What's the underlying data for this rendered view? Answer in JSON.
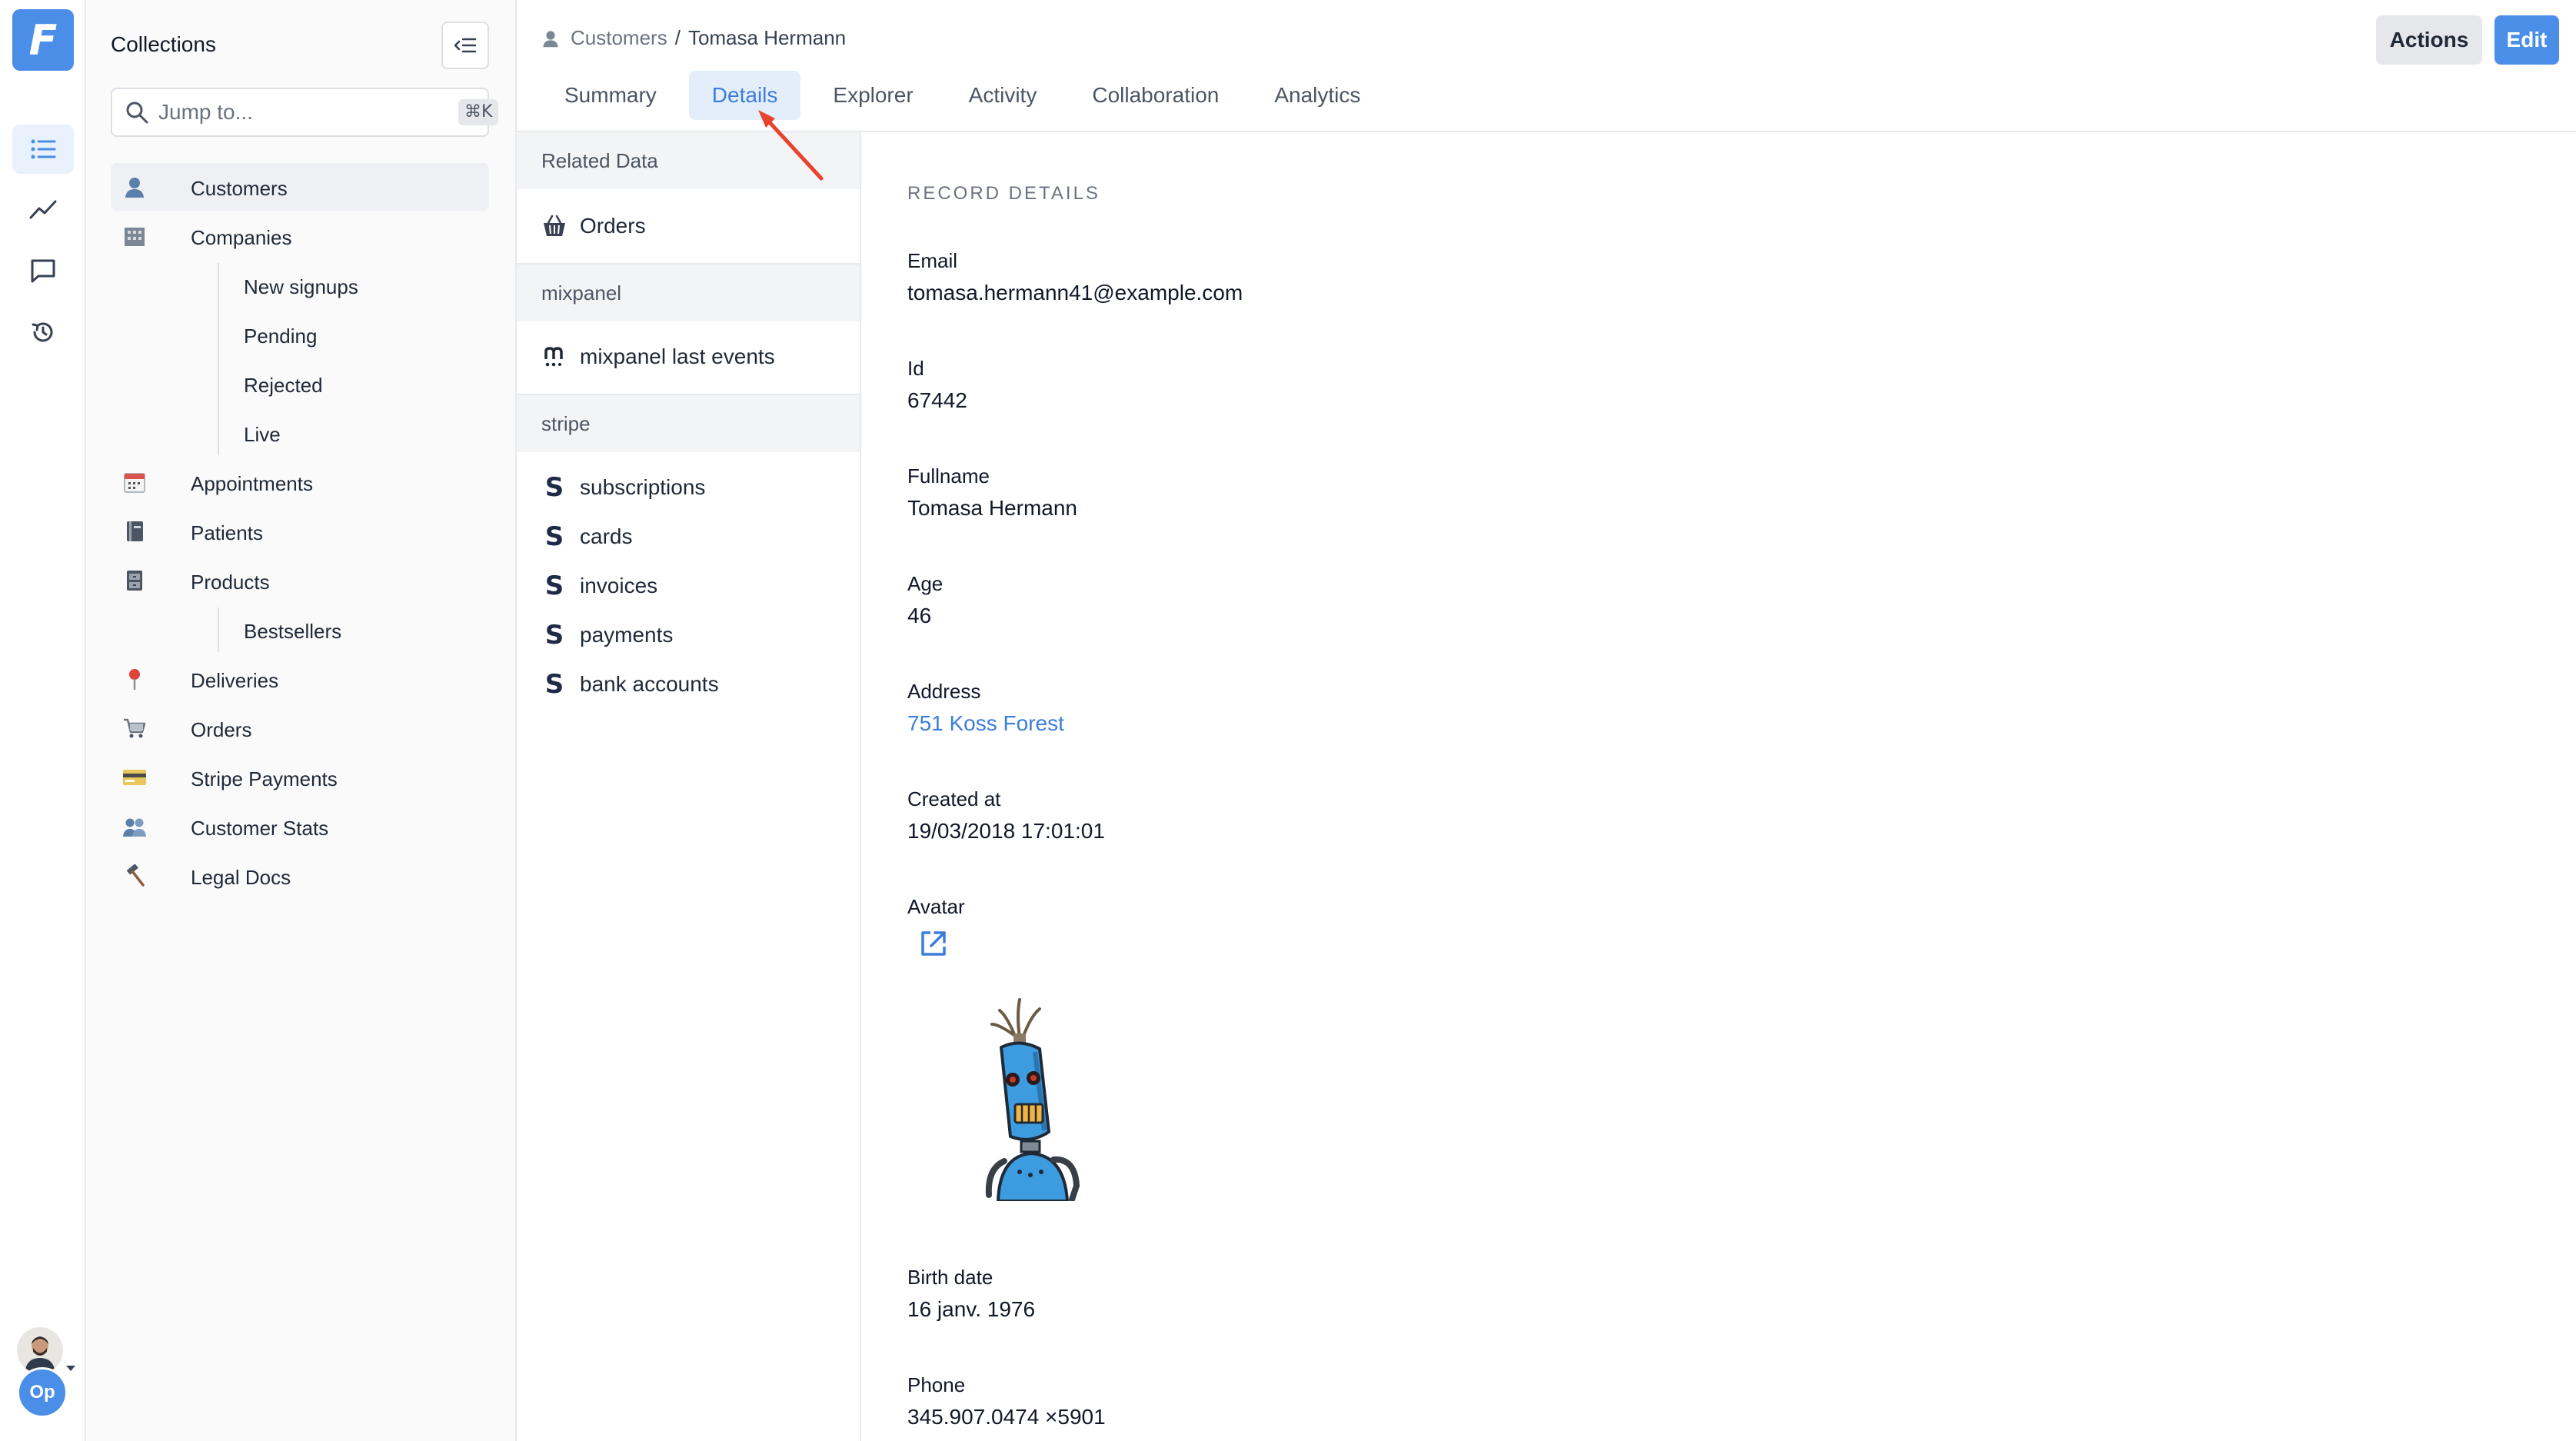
{
  "rail": {
    "logo_letter": "F",
    "org_badge": "Op"
  },
  "collections": {
    "title": "Collections",
    "search": {
      "placeholder": "Jump to...",
      "shortcut": "⌘K"
    },
    "items": [
      {
        "label": "Customers",
        "icon": "person-icon",
        "active": true
      },
      {
        "label": "Companies",
        "icon": "building-icon"
      },
      {
        "label": "New signups",
        "sub": true
      },
      {
        "label": "Pending",
        "sub": true
      },
      {
        "label": "Rejected",
        "sub": true
      },
      {
        "label": "Live",
        "sub": true
      },
      {
        "label": "Appointments",
        "icon": "calendar-icon"
      },
      {
        "label": "Patients",
        "icon": "notebook-icon"
      },
      {
        "label": "Products",
        "icon": "cabinet-icon"
      },
      {
        "label": "Bestsellers",
        "sub": true
      },
      {
        "label": "Deliveries",
        "icon": "pin-icon"
      },
      {
        "label": "Orders",
        "icon": "cart-icon"
      },
      {
        "label": "Stripe Payments",
        "icon": "credit-card-icon"
      },
      {
        "label": "Customer Stats",
        "icon": "people-icon"
      },
      {
        "label": "Legal Docs",
        "icon": "hammer-icon"
      }
    ]
  },
  "header": {
    "breadcrumb": {
      "collection": "Customers",
      "separator": "/",
      "record": "Tomasa Hermann"
    },
    "tabs": [
      "Summary",
      "Details",
      "Explorer",
      "Activity",
      "Collaboration",
      "Analytics"
    ],
    "active_tab": "Details",
    "actions_label": "Actions",
    "edit_label": "Edit"
  },
  "related": {
    "sections": [
      {
        "title": "Related Data",
        "items": [
          {
            "label": "Orders",
            "icon": "basket-icon"
          }
        ]
      },
      {
        "title": "mixpanel",
        "items": [
          {
            "label": "mixpanel last events",
            "icon": "mixpanel-icon"
          }
        ]
      },
      {
        "title": "stripe",
        "items": [
          {
            "label": "subscriptions",
            "icon": "stripe-icon"
          },
          {
            "label": "cards",
            "icon": "stripe-icon"
          },
          {
            "label": "invoices",
            "icon": "stripe-icon"
          },
          {
            "label": "payments",
            "icon": "stripe-icon"
          },
          {
            "label": "bank accounts",
            "icon": "stripe-icon"
          }
        ]
      }
    ]
  },
  "details": {
    "section_title": "RECORD DETAILS",
    "fields": [
      {
        "label": "Email",
        "value": "tomasa.hermann41@example.com"
      },
      {
        "label": "Id",
        "value": "67442"
      },
      {
        "label": "Fullname",
        "value": "Tomasa Hermann"
      },
      {
        "label": "Age",
        "value": "46"
      },
      {
        "label": "Address",
        "value": "751 Koss Forest",
        "link": true
      },
      {
        "label": "Created at",
        "value": "19/03/2018 17:01:01"
      },
      {
        "label": "Avatar",
        "value": ""
      },
      {
        "label": "Birth date",
        "value": "16 janv. 1976"
      },
      {
        "label": "Phone",
        "value": "345.907.0474 ×5901"
      }
    ]
  },
  "colors": {
    "accent": "#4a8ee8",
    "link": "#3b7ddd",
    "annotation_arrow": "#e8432e"
  }
}
